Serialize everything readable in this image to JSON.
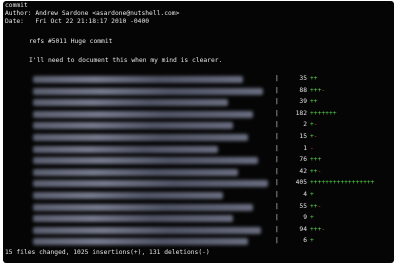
{
  "commit": {
    "header": "commit",
    "author": "Author: Andrew Sardone <asardone@nutshell.com>",
    "date": "Date:   Fri Oct 22 21:18:17 2010 -0400",
    "subject": "refs #5011 Huge commit",
    "message": "I'll need to document this when my mind is clearer."
  },
  "files": [
    {
      "count": "35",
      "plus": "++",
      "minus": ""
    },
    {
      "count": "88",
      "plus": "+++",
      "minus": "-"
    },
    {
      "count": "39",
      "plus": "++",
      "minus": ""
    },
    {
      "count": "182",
      "plus": "+++++++",
      "minus": ""
    },
    {
      "count": "2",
      "plus": "+",
      "minus": "-"
    },
    {
      "count": "15",
      "plus": "+",
      "minus": "-"
    },
    {
      "count": "1",
      "plus": "",
      "minus": "-"
    },
    {
      "count": "76",
      "plus": "+++",
      "minus": ""
    },
    {
      "count": "42",
      "plus": "++",
      "minus": "-"
    },
    {
      "count": "405",
      "plus": "+++++++++++++++++",
      "minus": ""
    },
    {
      "count": "4",
      "plus": "+",
      "minus": ""
    },
    {
      "count": "55",
      "plus": "++",
      "minus": "-"
    },
    {
      "count": "9",
      "plus": "+",
      "minus": ""
    },
    {
      "count": "94",
      "plus": "+++",
      "minus": "-"
    },
    {
      "count": "6",
      "plus": "+",
      "minus": ""
    }
  ],
  "summary": "15 files changed, 1025 insertions(+), 131 deletions(-)",
  "colors": {
    "background": "#050505",
    "text": "#e8e8e8",
    "insertion": "#56d64a",
    "deletion": "#e23a3a"
  }
}
